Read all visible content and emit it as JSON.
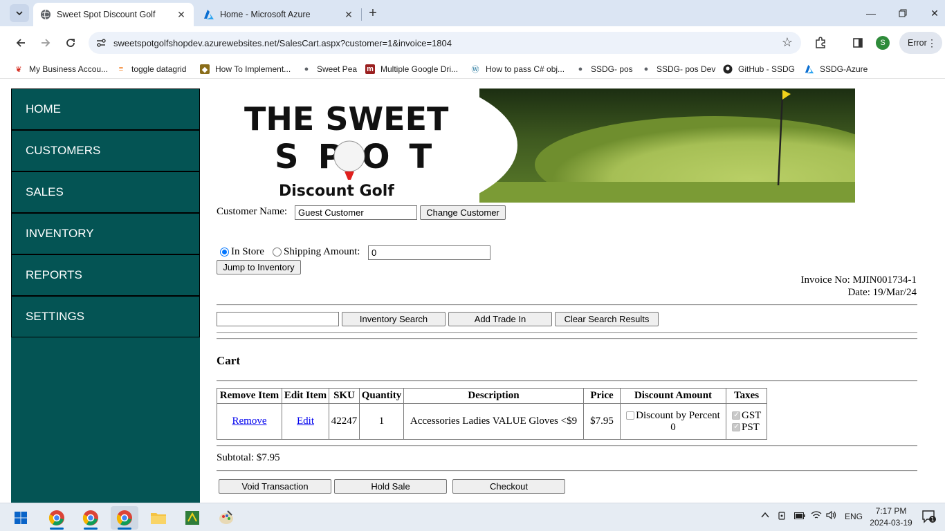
{
  "browser": {
    "tabs": [
      {
        "title": "Sweet Spot Discount Golf",
        "active": true
      },
      {
        "title": "Home - Microsoft Azure",
        "active": false
      }
    ],
    "url": "sweetspotgolfshopdev.azurewebsites.net/SalesCart.aspx?customer=1&invoice=1804",
    "profile_initial": "S",
    "error_label": "Error",
    "bookmarks": [
      "My Business Accou...",
      "toggle datagrid",
      "How To Implement...",
      "Sweet Pea",
      "Multiple Google Dri...",
      "How to pass C# obj...",
      "SSDG- pos",
      "SSDG- pos Dev",
      "GitHub - SSDG",
      "SSDG-Azure"
    ]
  },
  "sidebar": {
    "items": [
      "HOME",
      "CUSTOMERS",
      "SALES",
      "INVENTORY",
      "REPORTS",
      "SETTINGS"
    ]
  },
  "banner": {
    "line1": "THE SWEET",
    "line2": "SPOT",
    "line3": "Discount Golf"
  },
  "customer": {
    "label": "Customer Name:",
    "value": "Guest Customer",
    "change_button": "Change Customer"
  },
  "shipping": {
    "in_store_label": "In Store",
    "shipping_label": "Shipping Amount:",
    "amount_value": "0",
    "in_store_checked": true,
    "jump_button": "Jump to Inventory"
  },
  "invoice": {
    "number_text": "Invoice No: MJIN001734-1",
    "date_text": "Date: 19/Mar/24"
  },
  "search": {
    "value": "",
    "inventory_search_button": "Inventory Search",
    "add_trade_in_button": "Add Trade In",
    "clear_button": "Clear Search Results"
  },
  "cart": {
    "heading": "Cart",
    "columns": [
      "Remove Item",
      "Edit Item",
      "SKU",
      "Quantity",
      "Description",
      "Price",
      "Discount Amount",
      "Taxes"
    ],
    "rows": [
      {
        "remove": "Remove",
        "edit": "Edit",
        "sku": "42247",
        "quantity": "1",
        "description": "Accessories Ladies VALUE Gloves <$9",
        "price": "$7.95",
        "discount_label": "Discount by Percent",
        "discount_value": "0",
        "tax1": "GST",
        "tax2": "PST"
      }
    ],
    "subtotal": "Subtotal: $7.95"
  },
  "actions": {
    "void": "Void Transaction",
    "hold": "Hold Sale",
    "checkout": "Checkout"
  },
  "taskbar": {
    "language": "ENG",
    "time": "7:17 PM",
    "date": "2024-03-19",
    "notification_count": "1"
  }
}
